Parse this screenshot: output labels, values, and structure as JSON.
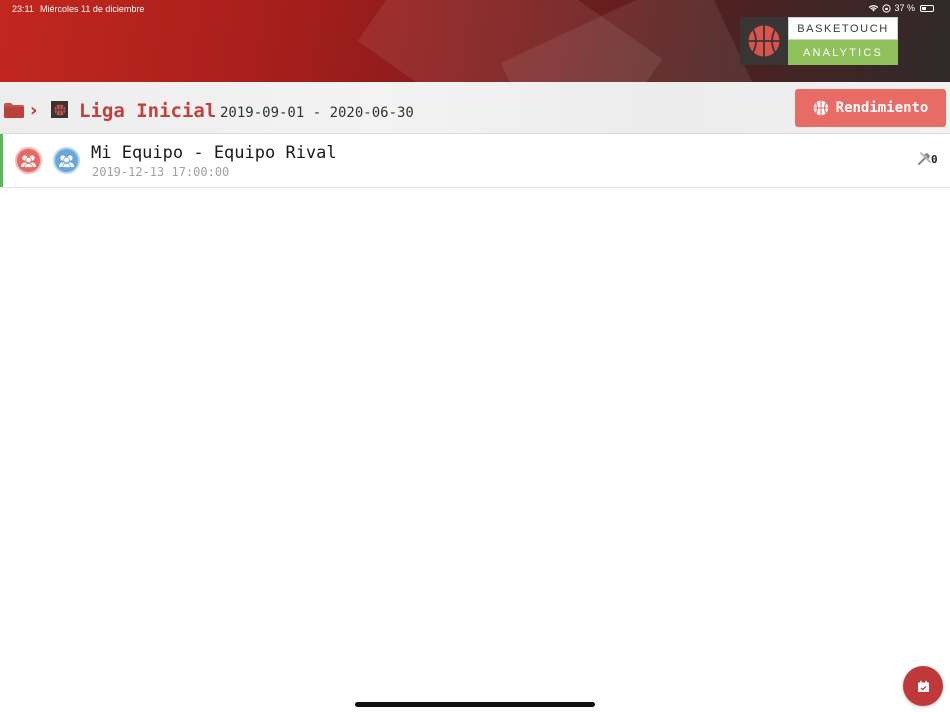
{
  "status_bar": {
    "time": "23:11",
    "date": "Miércoles 11 de diciembre",
    "battery": "37 %",
    "battery_level": 0.37
  },
  "logo": {
    "line1": "BASKETOUCH",
    "line2": "ANALYTICS"
  },
  "breadcrumb": {
    "league_name": "Liga Inicial",
    "league_dates": "2019-09-01 - 2020-06-30"
  },
  "actions": {
    "performance_label": "Rendimiento"
  },
  "matches": [
    {
      "title": "Mi Equipo - Equipo Rival",
      "datetime": "2019-12-13 17:00:00",
      "tool_count": "0"
    }
  ],
  "colors": {
    "accent_red": "#c0423b",
    "button_red": "#e96b66",
    "status_green": "#5cb85c",
    "home_team": "#e46a64",
    "away_team": "#6aa7d9",
    "logo_green": "#8fc25a"
  },
  "icons": {
    "folder": "folder-icon",
    "league": "basketball-icon",
    "performance": "basketball-icon",
    "tools": "tools-icon",
    "fab": "calendar-add-icon"
  }
}
